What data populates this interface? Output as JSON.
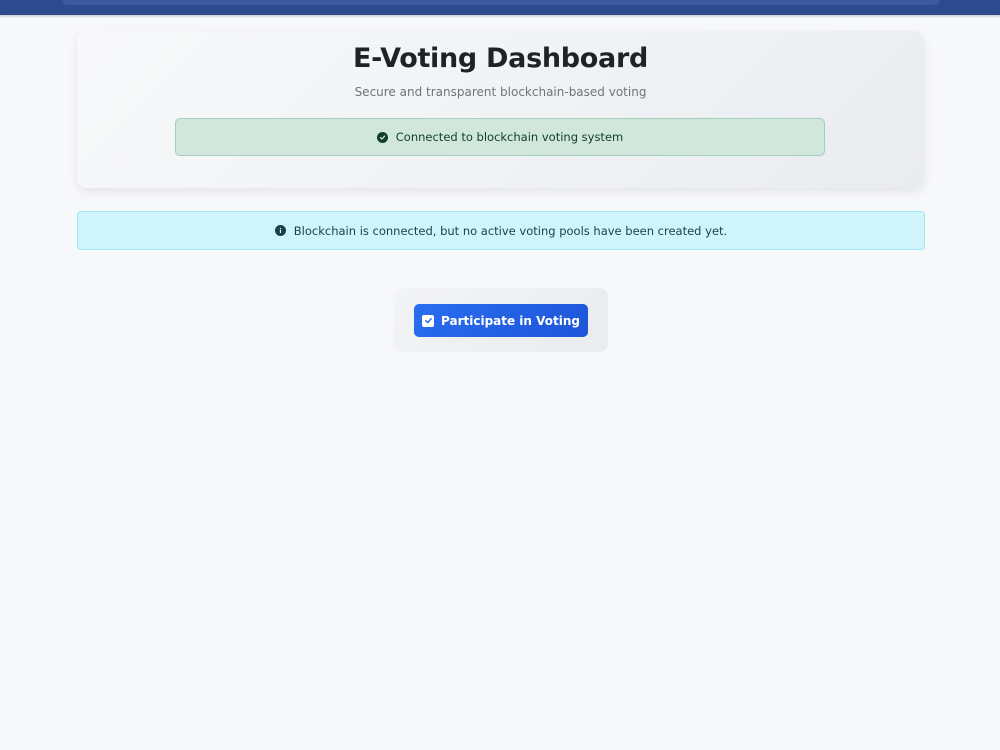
{
  "header": {
    "title": "E-Voting Dashboard",
    "subtitle": "Secure and transparent blockchain-based voting"
  },
  "alerts": {
    "connection": {
      "text": "Connected to blockchain voting system",
      "icon": "check-circle-icon"
    },
    "info": {
      "text": "Blockchain is connected, but no active voting pools have been created yet.",
      "icon": "info-circle-icon"
    }
  },
  "actions": {
    "participate_label": "Participate in Voting",
    "participate_icon": "check-square-icon"
  },
  "colors": {
    "accent": "#2563eb",
    "success_bg": "#d1e7dd",
    "info_bg": "#cff4fc",
    "topbar": "#2d4a8f"
  }
}
